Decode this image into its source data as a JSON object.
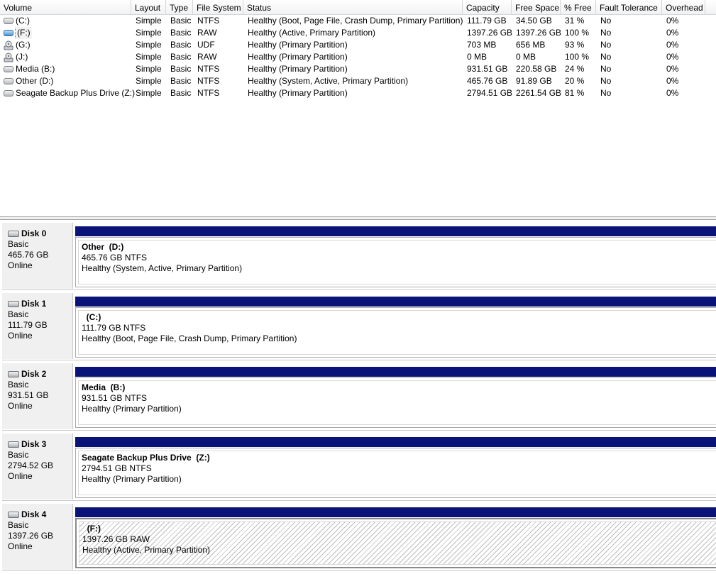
{
  "columns": [
    "Volume",
    "Layout",
    "Type",
    "File System",
    "Status",
    "Capacity",
    "Free Space",
    "% Free",
    "Fault Tolerance",
    "Overhead"
  ],
  "volumes": [
    {
      "name": "(C:)",
      "icon": "hard-drive-icon",
      "layout": "Simple",
      "type": "Basic",
      "fs": "NTFS",
      "status": "Healthy (Boot, Page File, Crash Dump, Primary Partition)",
      "capacity": "111.79 GB",
      "free": "34.50 GB",
      "pct": "31 %",
      "fault": "No",
      "overhead": "0%"
    },
    {
      "name": "(F:)",
      "icon": "external-drive-icon",
      "layout": "Simple",
      "type": "Basic",
      "fs": "RAW",
      "status": "Healthy (Active, Primary Partition)",
      "capacity": "1397.26 GB",
      "free": "1397.26 GB",
      "pct": "100 %",
      "fault": "No",
      "overhead": "0%"
    },
    {
      "name": "(G:)",
      "icon": "cd-drive-icon",
      "layout": "Simple",
      "type": "Basic",
      "fs": "UDF",
      "status": "Healthy (Primary Partition)",
      "capacity": "703 MB",
      "free": "656 MB",
      "pct": "93 %",
      "fault": "No",
      "overhead": "0%"
    },
    {
      "name": "(J:)",
      "icon": "cd-drive-icon",
      "layout": "Simple",
      "type": "Basic",
      "fs": "RAW",
      "status": "Healthy (Primary Partition)",
      "capacity": "0 MB",
      "free": "0 MB",
      "pct": "100 %",
      "fault": "No",
      "overhead": "0%"
    },
    {
      "name": "Media (B:)",
      "icon": "hard-drive-icon",
      "layout": "Simple",
      "type": "Basic",
      "fs": "NTFS",
      "status": "Healthy (Primary Partition)",
      "capacity": "931.51 GB",
      "free": "220.58 GB",
      "pct": "24 %",
      "fault": "No",
      "overhead": "0%"
    },
    {
      "name": "Other (D:)",
      "icon": "hard-drive-icon",
      "layout": "Simple",
      "type": "Basic",
      "fs": "NTFS",
      "status": "Healthy (System, Active, Primary Partition)",
      "capacity": "465.76 GB",
      "free": "91.89 GB",
      "pct": "20 %",
      "fault": "No",
      "overhead": "0%"
    },
    {
      "name": "Seagate Backup Plus Drive (Z:)",
      "icon": "hard-drive-icon",
      "layout": "Simple",
      "type": "Basic",
      "fs": "NTFS",
      "status": "Healthy (Primary Partition)",
      "capacity": "2794.51 GB",
      "free": "2261.54 GB",
      "pct": "81 %",
      "fault": "No",
      "overhead": "0%"
    }
  ],
  "disks": [
    {
      "title": "Disk 0",
      "type": "Basic",
      "size": "465.76 GB",
      "state": "Online",
      "part_name": "Other  (D:)",
      "part_size": "465.76 GB NTFS",
      "part_status": "Healthy (System, Active, Primary Partition)"
    },
    {
      "title": "Disk 1",
      "type": "Basic",
      "size": "111.79 GB",
      "state": "Online",
      "part_name": "  (C:)",
      "part_size": "111.79 GB NTFS",
      "part_status": "Healthy (Boot, Page File, Crash Dump, Primary Partition)"
    },
    {
      "title": "Disk 2",
      "type": "Basic",
      "size": "931.51 GB",
      "state": "Online",
      "part_name": "Media  (B:)",
      "part_size": "931.51 GB NTFS",
      "part_status": "Healthy (Primary Partition)"
    },
    {
      "title": "Disk 3",
      "type": "Basic",
      "size": "2794.52 GB",
      "state": "Online",
      "part_name": "Seagate Backup Plus Drive  (Z:)",
      "part_size": "2794.51 GB NTFS",
      "part_status": "Healthy (Primary Partition)"
    },
    {
      "title": "Disk 4",
      "type": "Basic",
      "size": "1397.26 GB",
      "state": "Online",
      "part_name": "  (F:)",
      "part_size": "1397.26 GB RAW",
      "part_status": "Healthy (Active, Primary Partition)"
    }
  ],
  "colors": {
    "partition_bar": "#0a1378",
    "disk_label_bg": "#f0f0f0"
  }
}
